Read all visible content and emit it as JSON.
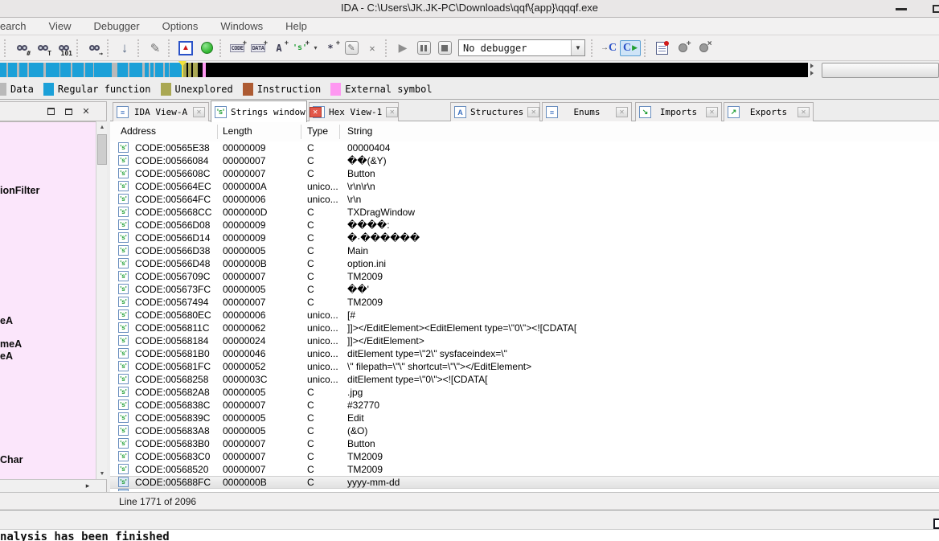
{
  "window": {
    "title": "IDA - C:\\Users\\JK.JK-PC\\Downloads\\qqf\\{app}\\qqqf.exe"
  },
  "menu": {
    "items": [
      "earch",
      "View",
      "Debugger",
      "Options",
      "Windows",
      "Help"
    ]
  },
  "toolbar": {
    "icons": {
      "plus": "+",
      "jump_immediate_sub": "#",
      "jump_text_sub": "T",
      "jump_binary_sub": "101",
      "jump_next_sub": "→",
      "arrow_down": "↓",
      "signature": "✎",
      "warning_triangle": "▲",
      "code": "CODE",
      "data": "DATA",
      "name": "A",
      "string": "'s'",
      "string_dropdown": "▾",
      "struct": "*",
      "edit": "✎",
      "delete": "✕",
      "play": "▶",
      "c_arrow": "→",
      "c_letter": "C",
      "c_play": "▶",
      "bp_plus": "+",
      "bp_delete": "×"
    },
    "debugger_combo": {
      "value": "No debugger",
      "arrow": "▼"
    }
  },
  "legend": {
    "items": [
      {
        "label": "Data",
        "color": "#b9b9b9"
      },
      {
        "label": "Regular function",
        "color": "#1ba0d8"
      },
      {
        "label": "Unexplored",
        "color": "#aaa853"
      },
      {
        "label": "Instruction",
        "color": "#ad5b33"
      },
      {
        "label": "External symbol",
        "color": "#fe98f1"
      }
    ]
  },
  "left_panel": {
    "labels": [
      "ionFilter",
      "eA",
      "meA",
      "eA",
      "Char"
    ],
    "scroll_up": "▲",
    "scroll_down": "▼",
    "scroll_right": "▸",
    "close": "✕"
  },
  "tabs": [
    {
      "label": "IDA View-A",
      "glyph": "≡",
      "glyph_color": "#3a6fbf",
      "active": false
    },
    {
      "label": "Strings window",
      "glyph": "'s'",
      "glyph_color": "#1f9e33",
      "active": true
    },
    {
      "label": "Hex View-1",
      "glyph": "○",
      "glyph_color": "#3a6fbf",
      "active": false
    },
    {
      "label": "Structures",
      "glyph": "A",
      "glyph_color": "#3a6fbf",
      "active": false
    },
    {
      "label": "Enums",
      "glyph": "≡",
      "glyph_color": "#3a6fbf",
      "active": false
    },
    {
      "label": "Imports",
      "glyph": "↘",
      "glyph_color": "#1f9e33",
      "active": false
    },
    {
      "label": "Exports",
      "glyph": "↗",
      "glyph_color": "#1f9e33",
      "active": false
    }
  ],
  "tab_close_glyph": "✕",
  "strings_table": {
    "columns": [
      "Address",
      "Length",
      "Type",
      "String"
    ],
    "row_icon": "'s'",
    "selected_index": 26,
    "rows": [
      {
        "addr": "CODE:00565E38",
        "len": "00000009",
        "type": "C",
        "str": "00000404"
      },
      {
        "addr": "CODE:00566084",
        "len": "00000007",
        "type": "C",
        "str": "��(&Y)"
      },
      {
        "addr": "CODE:0056608C",
        "len": "00000007",
        "type": "C",
        "str": "Button"
      },
      {
        "addr": "CODE:005664EC",
        "len": "0000000A",
        "type": "unico...",
        "str": "\\r\\n\\r\\n"
      },
      {
        "addr": "CODE:005664FC",
        "len": "00000006",
        "type": "unico...",
        "str": "\\r\\n"
      },
      {
        "addr": "CODE:005668CC",
        "len": "0000000D",
        "type": "C",
        "str": "TXDragWindow"
      },
      {
        "addr": "CODE:00566D08",
        "len": "00000009",
        "type": "C",
        "str": "����:"
      },
      {
        "addr": "CODE:00566D14",
        "len": "00000009",
        "type": "C",
        "str": "�·������"
      },
      {
        "addr": "CODE:00566D38",
        "len": "00000005",
        "type": "C",
        "str": "Main"
      },
      {
        "addr": "CODE:00566D48",
        "len": "0000000B",
        "type": "C",
        "str": "option.ini"
      },
      {
        "addr": "CODE:0056709C",
        "len": "00000007",
        "type": "C",
        "str": "TM2009"
      },
      {
        "addr": "CODE:005673FC",
        "len": "00000005",
        "type": "C",
        "str": "��'"
      },
      {
        "addr": "CODE:00567494",
        "len": "00000007",
        "type": "C",
        "str": "TM2009"
      },
      {
        "addr": "CODE:005680EC",
        "len": "00000006",
        "type": "unico...",
        "str": "[#"
      },
      {
        "addr": "CODE:0056811C",
        "len": "00000062",
        "type": "unico...",
        "str": "]]></EditElement><EditElement type=\\\"0\\\"><![CDATA["
      },
      {
        "addr": "CODE:00568184",
        "len": "00000024",
        "type": "unico...",
        "str": "]]></EditElement>"
      },
      {
        "addr": "CODE:005681B0",
        "len": "00000046",
        "type": "unico...",
        "str": "ditElement type=\\\"2\\\" sysfaceindex=\\\""
      },
      {
        "addr": "CODE:005681FC",
        "len": "00000052",
        "type": "unico...",
        "str": "\\\" filepath=\\\"\\\" shortcut=\\\"\\\"></EditElement>"
      },
      {
        "addr": "CODE:00568258",
        "len": "0000003C",
        "type": "unico...",
        "str": "ditElement type=\\\"0\\\"><![CDATA["
      },
      {
        "addr": "CODE:005682A8",
        "len": "00000005",
        "type": "C",
        "str": ".jpg"
      },
      {
        "addr": "CODE:0056838C",
        "len": "00000007",
        "type": "C",
        "str": "#32770"
      },
      {
        "addr": "CODE:0056839C",
        "len": "00000005",
        "type": "C",
        "str": "Edit"
      },
      {
        "addr": "CODE:005683A8",
        "len": "00000005",
        "type": "C",
        "str": "(&O)"
      },
      {
        "addr": "CODE:005683B0",
        "len": "00000007",
        "type": "C",
        "str": "Button"
      },
      {
        "addr": "CODE:005683C0",
        "len": "00000007",
        "type": "C",
        "str": "TM2009"
      },
      {
        "addr": "CODE:00568520",
        "len": "00000007",
        "type": "C",
        "str": "TM2009"
      },
      {
        "addr": "CODE:005688FC",
        "len": "0000000B",
        "type": "C",
        "str": "yyyy-mm-dd"
      }
    ]
  },
  "status": {
    "line_info": "Line 1771 of 2096"
  },
  "output": {
    "text": "nalysis has been finished"
  }
}
